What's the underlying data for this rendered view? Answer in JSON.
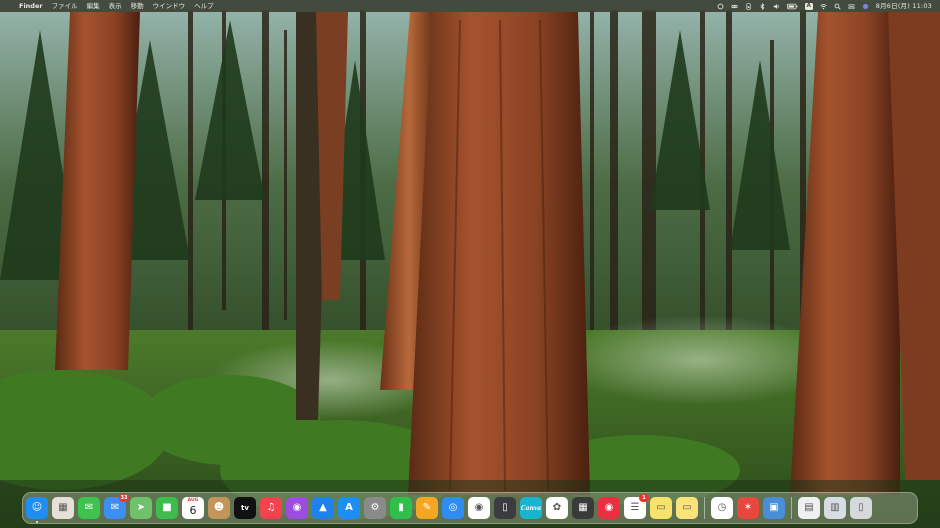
{
  "menubar": {
    "app_name": "Finder",
    "menus": [
      "ファイル",
      "編集",
      "表示",
      "移動",
      "ウインドウ",
      "ヘルプ"
    ],
    "status_icons": [
      "creative-cloud-icon",
      "link-icon",
      "speaker-icon",
      "bluetooth-icon",
      "audio-icon",
      "battery-icon",
      "input-method-icon",
      "wifi-icon",
      "search-icon",
      "control-center-icon",
      "siri-icon"
    ],
    "input_method": "A",
    "clock": "8月6日(月) 11:03"
  },
  "dock": {
    "items": [
      {
        "name": "finder",
        "color": "#1e8ef2",
        "running": true
      },
      {
        "name": "launchpad",
        "color": "#e6e0d8"
      },
      {
        "name": "messages",
        "color": "#3fc34f"
      },
      {
        "name": "mail",
        "color": "#3a8ff0",
        "badge": "33"
      },
      {
        "name": "maps",
        "color": "#6fc26a"
      },
      {
        "name": "facetime",
        "color": "#3dbe4c"
      },
      {
        "name": "calendar",
        "color": "#ffffff",
        "month": "AUG",
        "day": "6"
      },
      {
        "name": "contacts",
        "color": "#c4955a"
      },
      {
        "name": "apple-tv",
        "color": "#111111",
        "label": "tv"
      },
      {
        "name": "music",
        "color": "#f2434f"
      },
      {
        "name": "podcasts",
        "color": "#9c4de0"
      },
      {
        "name": "keynote",
        "color": "#1d82f0"
      },
      {
        "name": "app-store",
        "color": "#1c8ef5"
      },
      {
        "name": "system-preferences",
        "color": "#8a8a8a"
      },
      {
        "name": "numbers",
        "color": "#2fbf4a"
      },
      {
        "name": "pages",
        "color": "#f5a623"
      },
      {
        "name": "safari",
        "color": "#2f8cf1"
      },
      {
        "name": "chrome",
        "color": "#ffffff"
      },
      {
        "name": "iphone-mirroring",
        "color": "#3c3c40"
      },
      {
        "name": "canva",
        "color": "#18b5cf",
        "label": "Canva"
      },
      {
        "name": "photos",
        "color": "#ffffff"
      },
      {
        "name": "calculator",
        "color": "#3a3a3a"
      },
      {
        "name": "music-alt",
        "color": "#ea2f3f"
      },
      {
        "name": "reminders",
        "color": "#ffffff",
        "badge": "1"
      },
      {
        "name": "stickies",
        "color": "#f6e36c"
      },
      {
        "name": "notes",
        "color": "#fbe27a"
      },
      {
        "name": "clock",
        "color": "#ffffff"
      },
      {
        "name": "xmind",
        "color": "#e8473b"
      },
      {
        "name": "preview",
        "color": "#4a8fd6"
      },
      {
        "name": "downloads-stack",
        "color": "#f0f0f0"
      },
      {
        "name": "documents-stack",
        "color": "#d8dde4"
      },
      {
        "name": "trash",
        "color": "#d6d9dc"
      }
    ]
  }
}
